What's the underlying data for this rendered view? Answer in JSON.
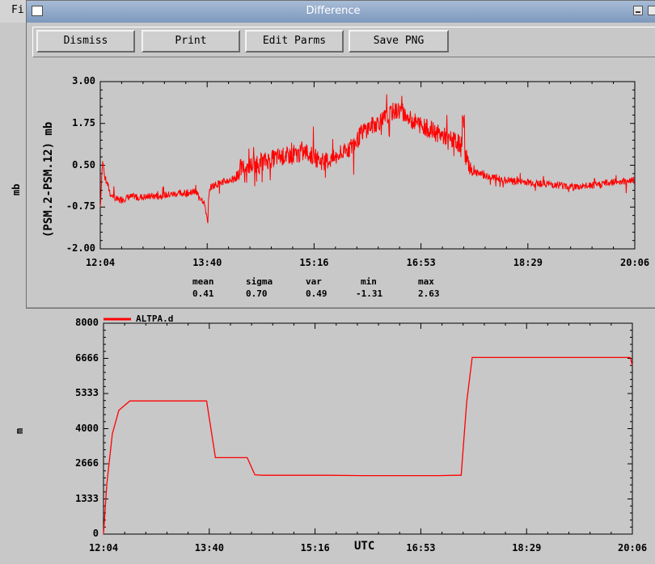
{
  "background_window": {
    "menu_file_partial": "Fi"
  },
  "dialog": {
    "title": "Difference",
    "buttons": {
      "dismiss": "Dismiss",
      "print": "Print",
      "edit_parms": "Edit Parms",
      "save_png": "Save PNG"
    }
  },
  "difference_plot": {
    "ylabel": "(PSM.2-PSM.12) mb",
    "outer_ylabel": "mb",
    "yticks": [
      "3.00",
      "1.75",
      "0.50",
      "-0.75",
      "-2.00"
    ],
    "xticks": [
      "12:04",
      "13:40",
      "15:16",
      "16:53",
      "18:29",
      "20:06"
    ],
    "stats": {
      "headers": [
        "mean",
        "sigma",
        "var",
        "min",
        "max"
      ],
      "values": [
        "0.41",
        "0.70",
        "0.49",
        "-1.31",
        "2.63"
      ]
    }
  },
  "altitude_plot": {
    "ylabel": "m",
    "xlabel": "UTC",
    "legend": "ALTPA.d",
    "yticks": [
      "8000",
      "6666",
      "5333",
      "4000",
      "2666",
      "1333",
      "0"
    ],
    "xticks": [
      "12:04",
      "13:40",
      "15:16",
      "16:53",
      "18:29",
      "20:06"
    ]
  },
  "chart_data": [
    {
      "type": "line",
      "title": "",
      "xlabel": "",
      "ylabel": "(PSM.2-PSM.12) mb",
      "xlim": [
        "12:04",
        "20:06"
      ],
      "ylim": [
        -2.0,
        3.0
      ],
      "grid": false,
      "color": "#ff0000",
      "series": [
        {
          "x": [
            "12:04",
            "12:06",
            "12:09",
            "12:13",
            "12:20",
            "12:30",
            "12:45",
            "13:00",
            "13:15",
            "13:30",
            "13:38",
            "13:41",
            "13:42",
            "13:46",
            "13:55",
            "14:06",
            "14:10",
            "14:20",
            "14:30",
            "14:45",
            "15:00",
            "15:10",
            "15:16",
            "15:25",
            "15:35",
            "15:45",
            "15:55",
            "16:00",
            "16:10",
            "16:20",
            "16:28",
            "16:35",
            "16:42",
            "16:53",
            "17:05",
            "17:15",
            "17:25",
            "17:30",
            "17:31",
            "17:33",
            "17:40",
            "17:55",
            "18:10",
            "18:29",
            "18:45",
            "19:00",
            "19:15",
            "19:30",
            "19:45",
            "20:06"
          ],
          "values": [
            -0.75,
            0.6,
            0.1,
            -0.35,
            -0.55,
            -0.45,
            -0.45,
            -0.4,
            -0.35,
            -0.3,
            -0.6,
            -1.3,
            -0.2,
            -0.1,
            0.0,
            0.1,
            0.4,
            0.5,
            0.6,
            0.75,
            0.8,
            0.9,
            0.75,
            0.6,
            0.7,
            0.9,
            1.2,
            1.5,
            1.7,
            1.9,
            2.1,
            2.15,
            1.9,
            1.7,
            1.5,
            1.35,
            1.2,
            1.1,
            2.3,
            0.8,
            0.3,
            0.15,
            0.05,
            0.0,
            -0.05,
            -0.1,
            -0.15,
            -0.1,
            0.0,
            0.05
          ]
        }
      ]
    },
    {
      "type": "line",
      "title": "",
      "xlabel": "UTC",
      "ylabel": "m",
      "xlim": [
        "12:04",
        "20:06"
      ],
      "ylim": [
        0,
        8000
      ],
      "grid": false,
      "legend": "top-left",
      "series": [
        {
          "name": "ALTPA.d",
          "color": "#ff0000",
          "x": [
            "12:04",
            "12:07",
            "12:12",
            "12:18",
            "12:28",
            "13:00",
            "13:30",
            "13:38",
            "13:46",
            "14:15",
            "14:22",
            "14:30",
            "15:00",
            "15:30",
            "16:00",
            "16:30",
            "16:53",
            "17:10",
            "17:25",
            "17:30",
            "17:35",
            "17:40",
            "18:00",
            "18:29",
            "19:00",
            "19:30",
            "20:04",
            "20:06"
          ],
          "values": [
            0,
            1900,
            3800,
            4700,
            5050,
            5050,
            5050,
            5050,
            2900,
            2900,
            2250,
            2230,
            2230,
            2230,
            2220,
            2220,
            2220,
            2220,
            2230,
            2230,
            5000,
            6700,
            6700,
            6700,
            6700,
            6700,
            6700,
            6400
          ]
        }
      ]
    }
  ]
}
